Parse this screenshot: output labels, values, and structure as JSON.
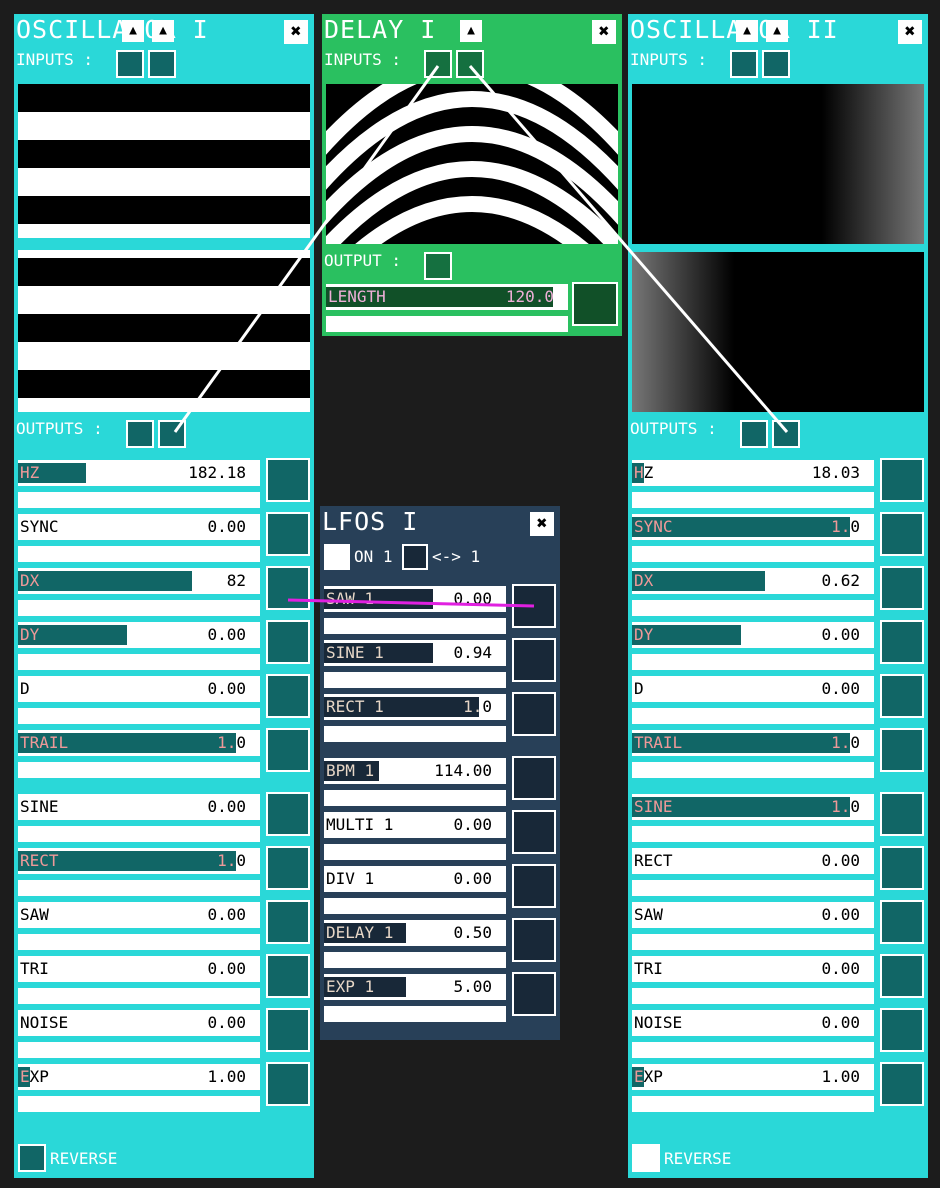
{
  "osc1": {
    "title": "OSCILLATOR I",
    "inputs": "INPUTS :",
    "outputs": "OUTPUTS :",
    "reverse": "REVERSE",
    "sliders": [
      {
        "name": "HZ",
        "value": "182.18",
        "fill": 0.28
      },
      {
        "name": "SYNC",
        "value": "0.00",
        "fill": 0.0
      },
      {
        "name": "DX",
        "value": "82",
        "fill": 0.72
      },
      {
        "name": "DY",
        "value": "0.00",
        "fill": 0.45
      },
      {
        "name": "D",
        "value": "0.00",
        "fill": 0.0
      },
      {
        "name": "TRAIL",
        "value": "1.0",
        "fill": 0.9
      },
      {
        "name": "SINE",
        "value": "0.00",
        "fill": 0.0
      },
      {
        "name": "RECT",
        "value": "1.0",
        "fill": 0.9
      },
      {
        "name": "SAW",
        "value": "0.00",
        "fill": 0.0
      },
      {
        "name": "TRI",
        "value": "0.00",
        "fill": 0.0
      },
      {
        "name": "NOISE",
        "value": "0.00",
        "fill": 0.0
      },
      {
        "name": "EXP",
        "value": "1.00",
        "fill": 0.05
      }
    ]
  },
  "delay": {
    "title": "DELAY I",
    "inputs": "INPUTS :",
    "output": "OUTPUT :",
    "length_name": "LENGTH",
    "length_value": "120.0"
  },
  "osc2": {
    "title": "OSCILLATOR II",
    "inputs": "INPUTS :",
    "outputs": "OUTPUTS :",
    "reverse": "REVERSE",
    "sliders": [
      {
        "name": "HZ",
        "value": "18.03",
        "fill": 0.05
      },
      {
        "name": "SYNC",
        "value": "1.0",
        "fill": 0.9
      },
      {
        "name": "DX",
        "value": "0.62",
        "fill": 0.55
      },
      {
        "name": "DY",
        "value": "0.00",
        "fill": 0.45
      },
      {
        "name": "D",
        "value": "0.00",
        "fill": 0.0
      },
      {
        "name": "TRAIL",
        "value": "1.0",
        "fill": 0.9
      },
      {
        "name": "SINE",
        "value": "1.0",
        "fill": 0.9
      },
      {
        "name": "RECT",
        "value": "0.00",
        "fill": 0.0
      },
      {
        "name": "SAW",
        "value": "0.00",
        "fill": 0.0
      },
      {
        "name": "TRI",
        "value": "0.00",
        "fill": 0.0
      },
      {
        "name": "NOISE",
        "value": "0.00",
        "fill": 0.0
      },
      {
        "name": "EXP",
        "value": "1.00",
        "fill": 0.05
      }
    ]
  },
  "lfos": {
    "title": "LFOS I",
    "on_label": "ON 1",
    "swap_label": "<-> 1",
    "sliders": [
      {
        "name": "SAW 1",
        "value": "0.00",
        "fill": 0.6
      },
      {
        "name": "SINE 1",
        "value": "0.94",
        "fill": 0.6
      },
      {
        "name": "RECT 1",
        "value": "1.0",
        "fill": 0.85
      },
      {
        "name": "BPM 1",
        "value": "114.00",
        "fill": 0.3
      },
      {
        "name": "MULTI 1",
        "value": "0.00",
        "fill": 0.0
      },
      {
        "name": "DIV 1",
        "value": "0.00",
        "fill": 0.0
      },
      {
        "name": "DELAY 1",
        "value": "0.50",
        "fill": 0.45
      },
      {
        "name": "EXP 1",
        "value": "5.00",
        "fill": 0.45
      }
    ]
  },
  "colors": {
    "cyan": "#2ad8d8",
    "teal": "#116666",
    "green": "#2ac060",
    "navy": "#284058",
    "lfo_line": "#e020e0"
  }
}
